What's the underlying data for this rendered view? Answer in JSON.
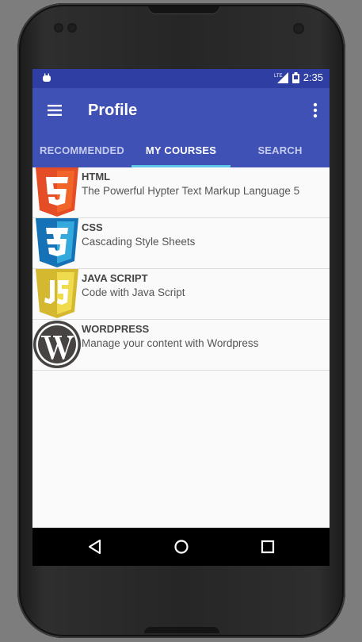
{
  "status": {
    "time": "2:35",
    "network": "LTE"
  },
  "appbar": {
    "title": "Profile"
  },
  "tabs": [
    {
      "label": "RECOMMENDED",
      "active": false
    },
    {
      "label": "MY COURSES",
      "active": true
    },
    {
      "label": "SEARCH",
      "active": false
    }
  ],
  "courses": [
    {
      "name": "HTML",
      "description": "The Powerful Hypter Text Markup Language 5",
      "logo": "html5-logo"
    },
    {
      "name": "CSS",
      "description": "Cascading Style Sheets",
      "logo": "css3-logo"
    },
    {
      "name": "JAVA SCRIPT",
      "description": "Code with Java Script",
      "logo": "javascript-logo"
    },
    {
      "name": "WORDPRESS",
      "description": "Manage your content with Wordpress",
      "logo": "wordpress-logo"
    }
  ],
  "colors": {
    "primary": "#3f51b5",
    "primary_dark": "#2f3ea3",
    "tab_indicator": "#5fc8e8"
  }
}
